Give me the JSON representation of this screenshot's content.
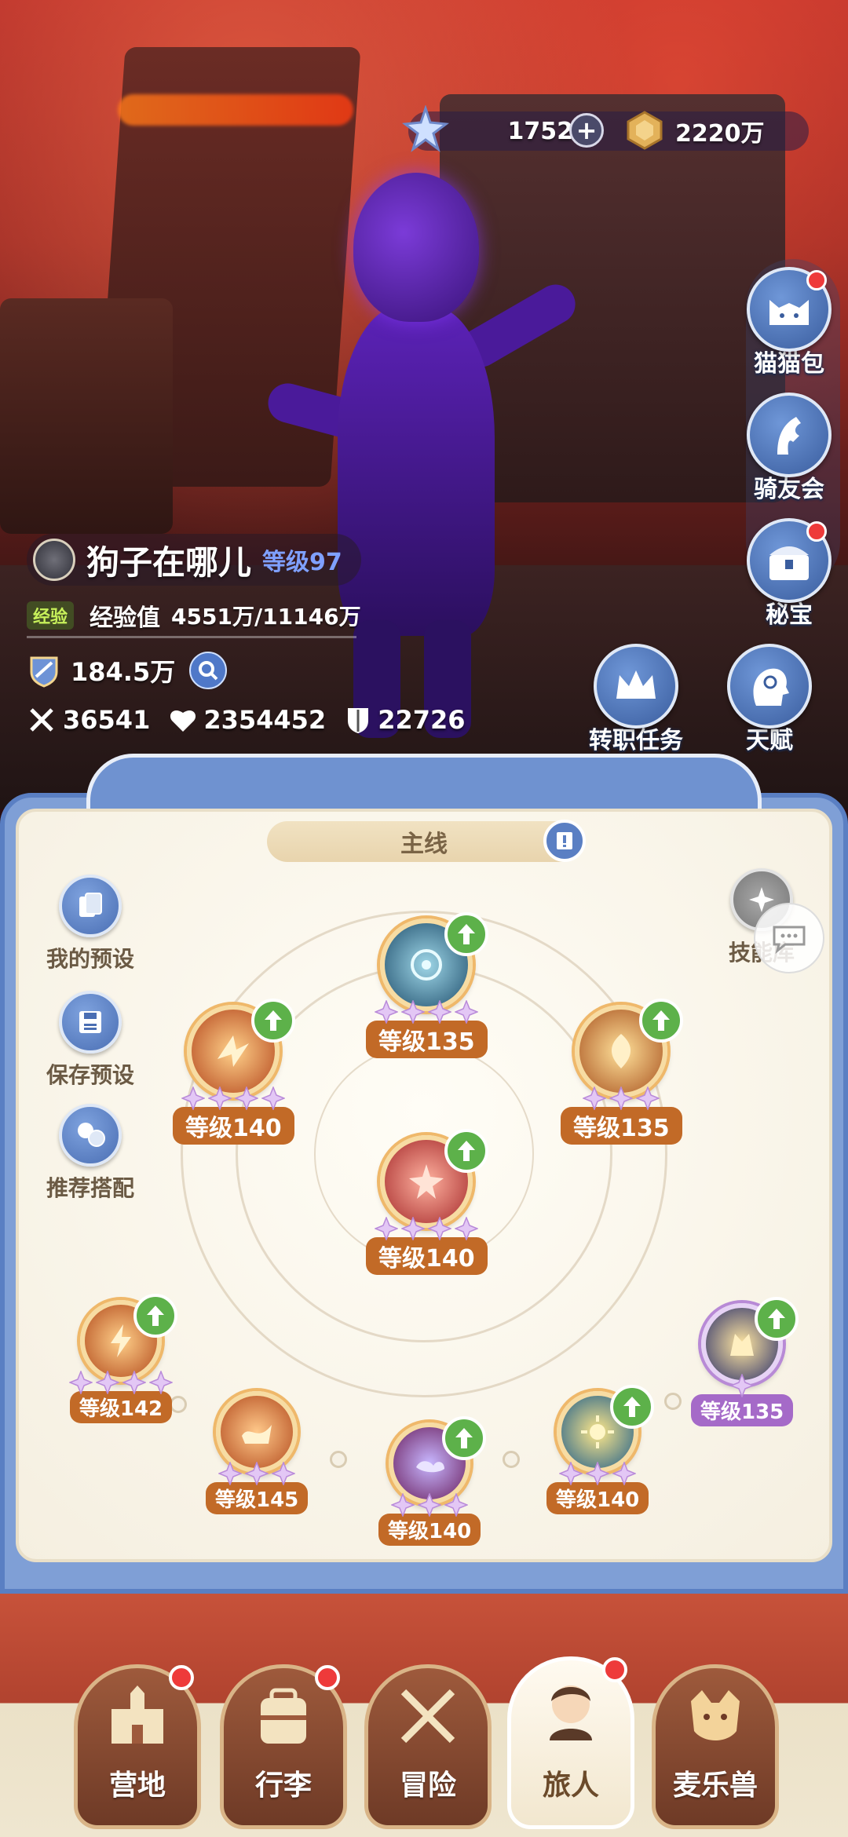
{
  "currency": {
    "gem_value": "1752",
    "add_label": "+",
    "gold_value": "2220万"
  },
  "side_menu": {
    "cat_bag": "猫猫包",
    "rider_club": "骑友会",
    "treasure": "秘宝",
    "job_quest": "转职任务",
    "talent": "天赋"
  },
  "player": {
    "name": "狗子在哪儿",
    "level": "等级97",
    "exp_tag": "经验",
    "exp_label": "经验值",
    "exp_value": "4551万/11146万",
    "power": "184.5万",
    "attack": "36541",
    "hp": "2354452",
    "defense": "22726"
  },
  "panel": {
    "title": "主线",
    "my_preset": "我的预设",
    "save_preset": "保存预设",
    "recommend": "推荐搭配",
    "skill_library": "技能库"
  },
  "skills": [
    {
      "id": "top",
      "level": "等级135",
      "stars": 4,
      "upgrade": true
    },
    {
      "id": "left",
      "level": "等级140",
      "stars": 4,
      "upgrade": true
    },
    {
      "id": "right",
      "level": "等级135",
      "stars": 3,
      "upgrade": true
    },
    {
      "id": "center",
      "level": "等级140",
      "stars": 4,
      "upgrade": true
    },
    {
      "id": "bottom1",
      "level": "等级142",
      "stars": 4,
      "upgrade": true
    },
    {
      "id": "bottom2",
      "level": "等级145",
      "stars": 3,
      "upgrade": false
    },
    {
      "id": "bottom3",
      "level": "等级140",
      "stars": 3,
      "upgrade": true
    },
    {
      "id": "bottom4",
      "level": "等级140",
      "stars": 3,
      "upgrade": true
    },
    {
      "id": "bottom5",
      "level": "等级135",
      "stars": 1,
      "upgrade": true
    }
  ],
  "nav": {
    "camp": "营地",
    "luggage": "行李",
    "adventure": "冒险",
    "traveler": "旅人",
    "pets": "麦乐兽"
  },
  "colors": {
    "accent_blue": "#5a7fc3",
    "level_tag": "#c26a27",
    "upgrade_green": "#5db14a",
    "notification_red": "#ee3a3a"
  }
}
